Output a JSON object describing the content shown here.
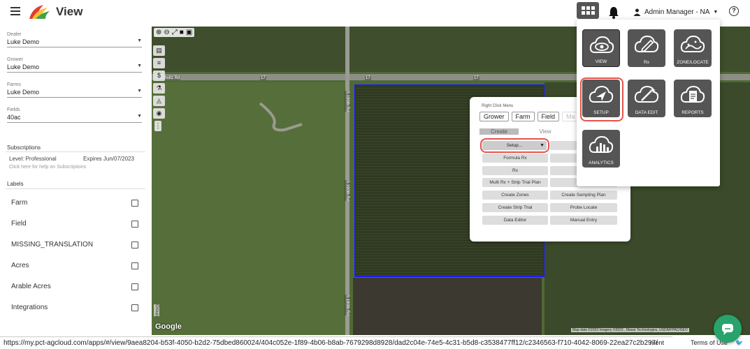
{
  "app": {
    "title": "View"
  },
  "header": {
    "user_label": "Admin Manager - NA"
  },
  "sidebar": {
    "fields": [
      {
        "label": "Dealer",
        "value": "Luke Demo"
      },
      {
        "label": "Grower",
        "value": "Luke Demo"
      },
      {
        "label": "Farms",
        "value": "Luke Demo"
      },
      {
        "label": "Fields",
        "value": "40ac"
      }
    ],
    "subscriptions": {
      "title": "Subscriptions",
      "level": "Level: Professional",
      "expires": "Expires Jun/07/2023",
      "hint": "Click here for help on Subscriptions"
    },
    "labels": {
      "title": "Labels",
      "items": [
        "Farm",
        "Field",
        "MISSING_TRANSLATION",
        "Acres",
        "Arable Acres",
        "Integrations"
      ]
    }
  },
  "map": {
    "road_labels": [
      "W Schultz Rd",
      "17",
      "17",
      "17",
      "S 190th Rd",
      "S 190th Rd",
      "S 190th Rd"
    ],
    "google": "Google",
    "attribution": "Map data ©2023 Imagery ©2023 , Maxar Technologies, USDA/FPAC/GEO",
    "side_label": "Group"
  },
  "right_click_menu": {
    "title": "Right Click Menu",
    "tabs": [
      "Grower",
      "Farm",
      "Field",
      "Ma"
    ],
    "subtabs": [
      "Create",
      "View",
      "P"
    ],
    "setup": "Setup...",
    "buttons": [
      "Formula Rx",
      "Add/E",
      "Rx",
      "Recrea",
      "Multi Rx + Strip Trial Plan",
      "Strip T",
      "Create Zones",
      "Create Sampling Plan",
      "Create Strip Trial",
      "Probe Locate",
      "Data Editor",
      "Manual Entry"
    ],
    "right_column_top": "Im"
  },
  "apps_panel": {
    "tiles": [
      {
        "label": "VIEW",
        "icon": "cloud-eye-icon"
      },
      {
        "label": "Rx",
        "icon": "cloud-pencil-icon"
      },
      {
        "label": "ZONE/LOCATE",
        "icon": "cloud-zone-icon"
      },
      {
        "label": "SETUP",
        "icon": "cloud-navigation-icon"
      },
      {
        "label": "DATA EDIT",
        "icon": "cloud-wand-icon"
      },
      {
        "label": "REPORTS",
        "icon": "cloud-document-icon"
      },
      {
        "label": "ANALYTICS",
        "icon": "cloud-chart-icon"
      }
    ]
  },
  "footer": {
    "url": "https://my.pct-agcloud.com/apps/#/view/9aea8204-b53f-4050-b2d2-75dbed860024/404c052e-1f89-4b06-b8ab-7679298d8928/dad2c04e-74e5-4c31-b5d8-c3538477ff12/c2346563-f710-4042-8069-22ea27c2b297/",
    "behind_url": "ment",
    "terms": "Terms of Use"
  }
}
